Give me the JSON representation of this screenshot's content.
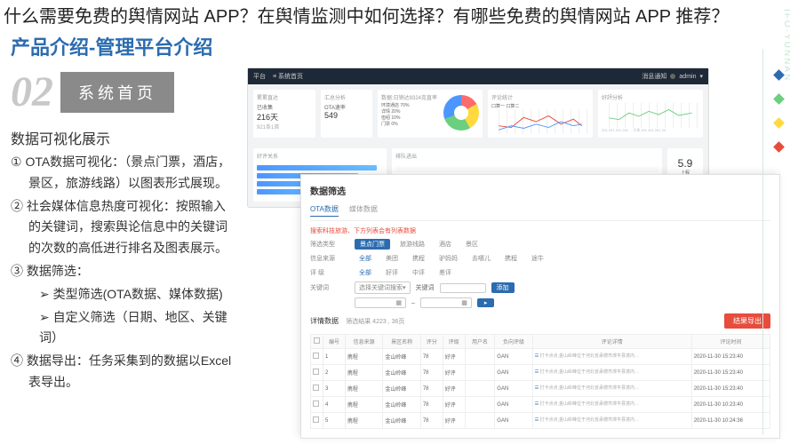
{
  "page": {
    "main_title": "什么需要免费的舆情网站 APP？在舆情监测中如何选择？有哪些免费的舆情网站 APP 推荐？",
    "section_title": "产品介绍-管理平台介绍",
    "watermark": "IFO·YUNNAN"
  },
  "badge": {
    "number": "02",
    "label": "系统首页"
  },
  "description": {
    "title": "数据可视化展示",
    "items": [
      "① OTA数据可视化：（景点门票，酒店，景区，旅游线路）以图表形式展现。",
      "② 社会媒体信息热度可视化：按照输入的关键词，搜索舆论信息中的关键词的次数的高低进行排名及图表展示。",
      "③ 数据筛选：",
      "类型筛选(OTA数据、媒体数据)",
      "自定义筛选（日期、地区、关键词）",
      "④ 数据导出：任务采集到的数据以Excel表导出。"
    ]
  },
  "dashboard_back": {
    "platform_label": "平台",
    "nav": "系统首页",
    "user": "admin",
    "notif": "消息通知",
    "cards": {
      "c1_title": "累累直达",
      "c1_val1": "已收集",
      "c1_val2": "216天",
      "c1_val3": "921条1首",
      "c2_title": "汇总分析",
      "c2_sub": "OTA速率",
      "c2_num": "549",
      "c3_title": "数据:日销达9324克直率",
      "c3_items": [
        "环境通店 70%",
        "详情 20%",
        "但绍 10%",
        "门票 0%"
      ],
      "c4_title": "评论统计",
      "c4_legend": "口算一 口算二",
      "c5_title": "好評分析",
      "c5_dates": "201 201 201 201 …于承 201 201 201 20"
    }
  },
  "dashboard_front": {
    "title": "数据筛选",
    "tabs": [
      "OTA数据",
      "媒体数据"
    ],
    "filters": {
      "label1": "筛选类型",
      "row1": [
        "景点门票",
        "旅游线路",
        "酒店",
        "景区"
      ],
      "label2": "信息来源",
      "row2_all": "全部",
      "row2": [
        "美团",
        "携程",
        "驴妈妈",
        "去哪儿",
        "携程",
        "途牛"
      ],
      "label3": "评 级",
      "row3_all": "全部",
      "row3": [
        "好评",
        "中评",
        "差评"
      ],
      "label4": "关键词",
      "select1": "选择关键词搜索",
      "kw_label": "关键词",
      "add_btn": "添加"
    },
    "result_label": "详情数据",
    "result_count": "筛选结果 4223 , 36页",
    "export_btn": "结果导出",
    "table": {
      "headers": [
        "",
        "编号",
        "信息来源",
        "景区名称",
        "评分",
        "评级",
        "用户名",
        "负向评级",
        "评论详情",
        "评论时间"
      ],
      "rows": [
        [
          "1",
          "携程",
          "金山岭峰",
          "78",
          "好评",
          "GAN",
          "打卡点点,金山岭峰位于河北省承德市滦平县境内…",
          "2020-11-30 15:23:40"
        ],
        [
          "2",
          "携程",
          "金山岭峰",
          "78",
          "好评",
          "GAN",
          "打卡点点,金山岭峰位于河北省承德市滦平县境内…",
          "2020-11-30 15:23:40"
        ],
        [
          "3",
          "携程",
          "金山岭峰",
          "78",
          "好评",
          "GAN",
          "打卡点点,金山岭峰位于河北省承德市滦平县境内…",
          "2020-11-30 15:23:40"
        ],
        [
          "4",
          "携程",
          "金山岭峰",
          "78",
          "好评",
          "GAN",
          "打卡点点,金山岭峰位于河北省承德市滦平县境内…",
          "2020-11-30 10:23:40"
        ],
        [
          "5",
          "携程",
          "金山岭峰",
          "78",
          "好评",
          "GAN",
          "打卡点点,金山岭峰位于河北省承德市滦平县境内…",
          "2020-11-30 10:24:36"
        ]
      ]
    },
    "red_notice": "搜索科技旅游、下方列表会有列表数据"
  },
  "decor_colors": [
    "#2b6cb0",
    "#6bcf7f",
    "#ffd93d",
    "#e74c3c"
  ]
}
